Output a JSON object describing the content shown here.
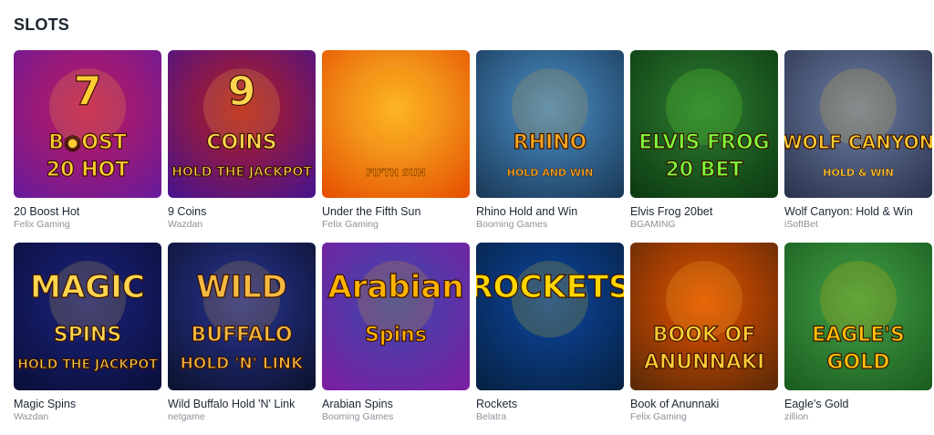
{
  "section": {
    "title": "SLOTS"
  },
  "games": [
    {
      "name": "20 Boost Hot",
      "provider": "Felix Gaming",
      "art": {
        "line1": "7",
        "line2": "B◉OST",
        "line3": "20 HOT",
        "bg1": "#c2185b",
        "bg2": "#6a1b9a",
        "fg": "#ffcc33"
      }
    },
    {
      "name": "9 Coins",
      "provider": "Wazdan",
      "art": {
        "line1": "9",
        "line2": "COINS",
        "line3": "HOLD THE JACKPOT",
        "bg1": "#b71c1c",
        "bg2": "#4a148c",
        "fg": "#ffd54f"
      }
    },
    {
      "name": "Under the Fifth Sun",
      "provider": "Felix Gaming",
      "art": {
        "line1": "",
        "line2": "",
        "line3": "FIFTH SUN",
        "bg1": "#fbc02d",
        "bg2": "#e65100",
        "fg": "#ff8a00"
      }
    },
    {
      "name": "Rhino Hold and Win",
      "provider": "Booming Games",
      "art": {
        "line1": "",
        "line2": "RHINO",
        "line3": "HOLD AND WIN",
        "bg1": "#4a90c8",
        "bg2": "#1b3b5a",
        "fg": "#f5a623"
      }
    },
    {
      "name": "Elvis Frog 20bet",
      "provider": "BGAMING",
      "art": {
        "line1": "",
        "line2": "ELVIS FROG",
        "line3": "20 BET",
        "bg1": "#2e7d32",
        "bg2": "#0d3b12",
        "fg": "#7cff3a"
      }
    },
    {
      "name": "Wolf Canyon: Hold & Win",
      "provider": "iSoftBet",
      "art": {
        "line1": "",
        "line2": "WOLF CANYON",
        "line3": "HOLD & WIN",
        "bg1": "#6d7fa3",
        "bg2": "#2c3550",
        "fg": "#ffcc33"
      }
    },
    {
      "name": "Magic Spins",
      "provider": "Wazdan",
      "art": {
        "line1": "MAGIC",
        "line2": "SPINS",
        "line3": "HOLD THE JACKPOT",
        "bg1": "#1a237e",
        "bg2": "#0b0f3a",
        "fg": "#ffd54f"
      }
    },
    {
      "name": "Wild Buffalo Hold 'N' Link",
      "provider": "netgame",
      "art": {
        "line1": "WILD",
        "line2": "BUFFALO",
        "line3": "HOLD 'N' LINK",
        "bg1": "#283593",
        "bg2": "#0d1330",
        "fg": "#f5b942"
      }
    },
    {
      "name": "Arabian Spins",
      "provider": "Booming Games",
      "art": {
        "line1": "Arabian",
        "line2": "Spins",
        "line3": "",
        "bg1": "#3949ab",
        "bg2": "#7b1fa2",
        "fg": "#ffb300"
      }
    },
    {
      "name": "Rockets",
      "provider": "Belatra",
      "art": {
        "line1": "ROCKETS",
        "line2": "",
        "line3": "",
        "bg1": "#0d47a1",
        "bg2": "#062244",
        "fg": "#ffd600"
      }
    },
    {
      "name": "Book of Anunnaki",
      "provider": "Felix Gaming",
      "art": {
        "line1": "",
        "line2": "BOOK OF",
        "line3": "ANUNNAKI",
        "bg1": "#e65100",
        "bg2": "#5d2a06",
        "fg": "#ffcc33"
      }
    },
    {
      "name": "Eagle's Gold",
      "provider": "zillion",
      "art": {
        "line1": "",
        "line2": "EAGLE'S",
        "line3": "GOLD",
        "bg1": "#43a047",
        "bg2": "#1b5e20",
        "fg": "#ffc107"
      }
    }
  ]
}
